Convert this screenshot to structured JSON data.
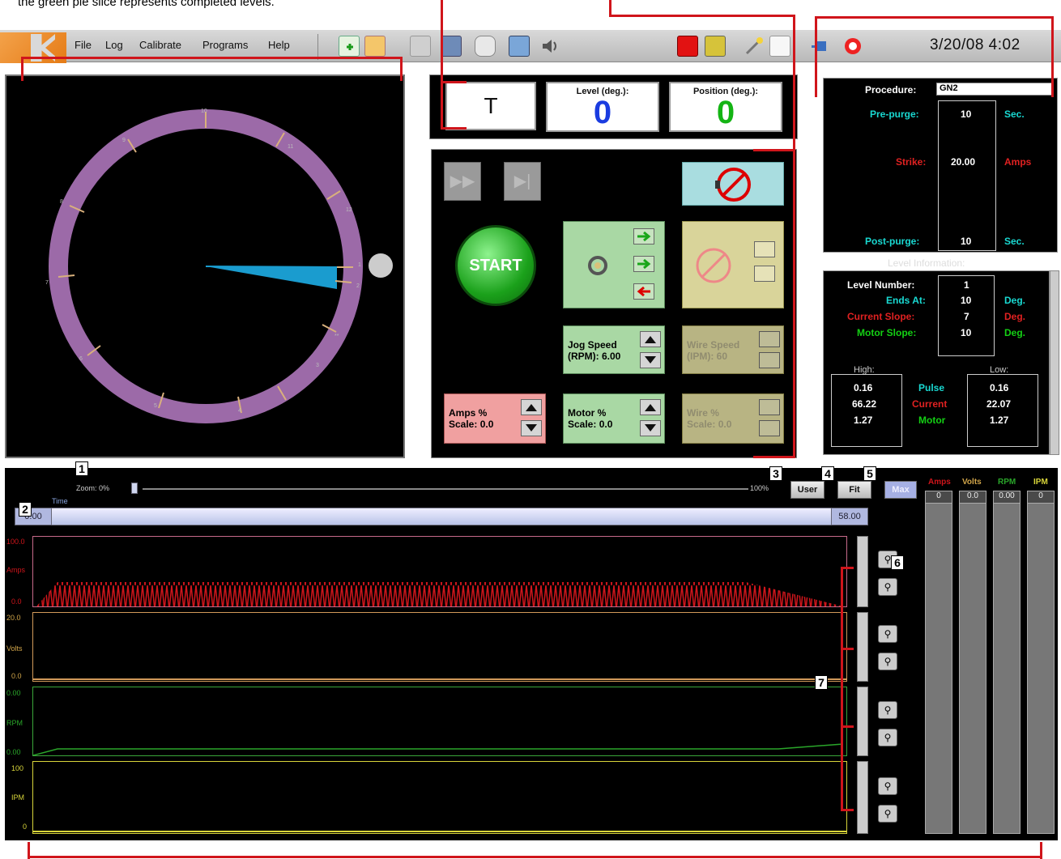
{
  "caption": "the green pie slice represents completed levels.",
  "menu": {
    "file": "File",
    "log": "Log",
    "calibrate": "Calibrate",
    "programs": "Programs",
    "help": "Help"
  },
  "toolbar": {
    "icons": [
      "new-icon",
      "open-folder-icon",
      "save-icon",
      "edit-icon",
      "trash-icon",
      "print-icon",
      "sound-icon",
      "record-icon",
      "sensor-icon",
      "wand-icon",
      "note-icon",
      "plug-icon",
      "lifebuoy-icon"
    ]
  },
  "datetime": "3/20/08   4:02",
  "clock": {
    "numbers": [
      "10",
      "11",
      "12",
      "1",
      "2",
      "**",
      "3",
      "4",
      "5",
      "6",
      "7",
      "8",
      "9"
    ],
    "ring_color": "#9c6aa8",
    "slice_color": "#1a9ccf"
  },
  "status": {
    "mode": "T",
    "level_label": "Level (deg.):",
    "level_value": "0",
    "position_label": "Position (deg.):",
    "position_value": "0"
  },
  "controls": {
    "start": "START",
    "jog_speed": "Jog Speed\n(RPM): 6.00",
    "wire_speed": "Wire Speed\n(IPM): 60",
    "amps_scale": "Amps %\nScale: 0.0",
    "motor_scale": "Motor %\nScale: 0.0",
    "wire_scale": "Wire %\nScale: 0.0"
  },
  "procedure": {
    "label": "Procedure:",
    "value": "GN2",
    "prepurge_label": "Pre-purge:",
    "prepurge_value": "10",
    "prepurge_unit": "Sec.",
    "strike_label": "Strike:",
    "strike_value": "20.00",
    "strike_unit": "Amps",
    "postpurge_label": "Post-purge:",
    "postpurge_value": "10",
    "postpurge_unit": "Sec."
  },
  "level_info": {
    "title": "Level Information:",
    "level_number_label": "Level Number:",
    "level_number_value": "1",
    "ends_at_label": "Ends At:",
    "ends_at_value": "10",
    "ends_at_unit": "Deg.",
    "current_slope_label": "Current Slope:",
    "current_slope_value": "7",
    "current_slope_unit": "Deg.",
    "motor_slope_label": "Motor Slope:",
    "motor_slope_value": "10",
    "motor_slope_unit": "Deg.",
    "high_label": "High:",
    "low_label": "Low:",
    "high_values": [
      "0.16",
      "66.22",
      "1.27"
    ],
    "row_labels": [
      "Pulse",
      "Current",
      "Motor"
    ],
    "low_values": [
      "0.16",
      "22.07",
      "1.27"
    ]
  },
  "graph": {
    "zoom_label": "Zoom: 0%",
    "zoom_max": "100%",
    "time_label": "Time",
    "time_start": "0.00",
    "time_end": "58.00",
    "user_btn": "User",
    "fit_btn": "Fit",
    "max_btn": "Max",
    "amps_top": "100.0",
    "amps_label": "Amps",
    "amps_bottom": "0.0",
    "volts_top": "20.0",
    "volts_label": "Volts",
    "volts_bottom": "0.0",
    "rpm_top": "0.00",
    "rpm_label": "RPM",
    "rpm_bottom": "0.00",
    "ipm_top": "100",
    "ipm_label": "IPM",
    "ipm_bottom": "0"
  },
  "meters": [
    {
      "name": "Amps",
      "value": "0",
      "color": "#d0151b"
    },
    {
      "name": "Volts",
      "value": "0.0",
      "color": "#d2a64a"
    },
    {
      "name": "RPM",
      "value": "0.00",
      "color": "#2aa62a"
    },
    {
      "name": "IPM",
      "value": "0",
      "color": "#d8d53a"
    }
  ],
  "callouts": [
    "1",
    "2",
    "3",
    "4",
    "5",
    "6",
    "7"
  ]
}
